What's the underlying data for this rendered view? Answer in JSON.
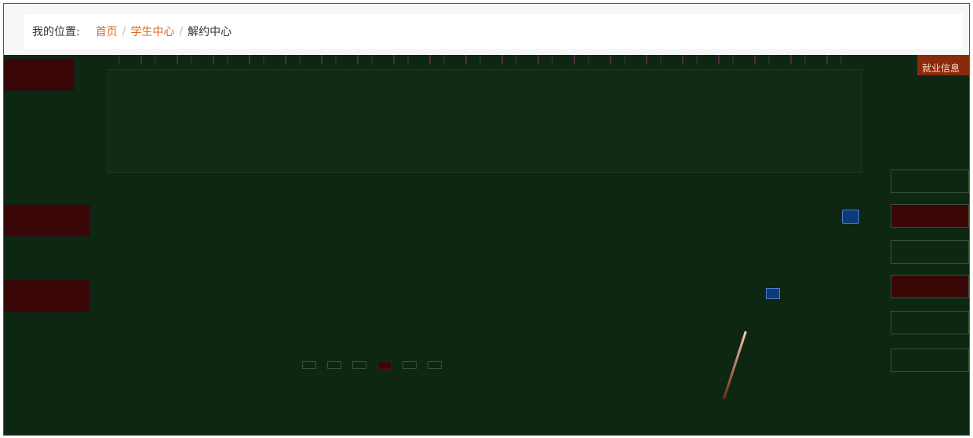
{
  "breadcrumb": {
    "label": "我的位置:",
    "home": "首页",
    "separator": "/",
    "student_center": "学生中心",
    "current": "解约中心"
  },
  "right_panel": {
    "top_label": "就业信息"
  },
  "colors": {
    "accent_link": "#d9682a",
    "frame_border": "#2d5f8a",
    "glitch_bg": "#0e2713",
    "sidebar_red": "#3b0606",
    "button_blue": "#0d3b78"
  }
}
